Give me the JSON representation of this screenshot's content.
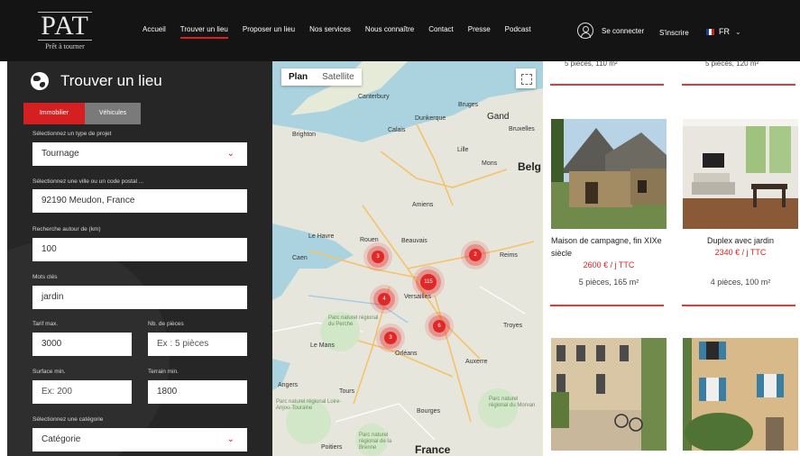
{
  "header": {
    "logo_text": "PAT",
    "logo_subtitle": "Prêt à tourner",
    "nav": [
      "Accueil",
      "Trouver un lieu",
      "Proposer un lieu",
      "Nos services",
      "Nous connaître",
      "Contact",
      "Presse",
      "Podcast"
    ],
    "login_label": "Se connecter",
    "signup_label": "S'inscrire",
    "language": "FR"
  },
  "search": {
    "title": "Trouver un lieu",
    "tabs": [
      "Immobilier",
      "Véhicules"
    ],
    "project_type_label": "Sélectionnez un type de projet",
    "project_type_value": "Tournage",
    "city_label": "Sélectionnez une ville ou un code postal ...",
    "city_value": "92190 Meudon, France",
    "radius_label": "Recherche autour de (km)",
    "radius_value": "100",
    "keywords_label": "Mots clés",
    "keywords_value": "jardin",
    "max_rate_label": "Tarif max.",
    "max_rate_value": "3000",
    "rooms_label": "Nb. de pièces",
    "rooms_placeholder": "Ex : 5 pièces",
    "min_surface_label": "Surface min.",
    "min_surface_placeholder": "Ex: 200",
    "min_land_label": "Terrain min.",
    "min_land_value": "1800",
    "category_label": "Sélectionnez une catégorie",
    "category_value": "Catégorie"
  },
  "map": {
    "view_plan": "Plan",
    "view_satellite": "Satellite",
    "places": [
      "Canterbury",
      "Brighton",
      "Calais",
      "Dunkerque",
      "Bruges",
      "Gand",
      "Bruxelles",
      "Lille",
      "Mons",
      "Belg",
      "Amiens",
      "Le Havre",
      "Rouen",
      "Beauvais",
      "Reims",
      "Caen",
      "Versailles",
      "Parc naturel régional du Perche",
      "Le Mans",
      "Orléans",
      "Troyes",
      "Angers",
      "Tours",
      "Bourges",
      "Auxerre",
      "Parc naturel régional Loire-Anjou-Touraine",
      "Parc naturel régional du Morvan",
      "Poitiers",
      "France",
      "Parc naturel régional de la Brenne"
    ],
    "markers": [
      "3",
      "2",
      "115",
      "4",
      "6",
      "3"
    ]
  },
  "listings": {
    "top_left_rooms": "5 pièces, 110 m²",
    "top_right_rooms": "5 pièces, 120 m²",
    "items": [
      {
        "title": "Maison de campagne, fin XIXe siècle",
        "price": "2600 € / j TTC",
        "rooms": "5 pièces, 165 m²"
      },
      {
        "title": "Duplex avec jardin",
        "price": "2340 € / j TTC",
        "rooms": "4 pièces, 100 m²"
      }
    ]
  },
  "colors": {
    "accent": "#d42020",
    "header_bg": "#141414",
    "sidebar_bg": "#262626"
  }
}
